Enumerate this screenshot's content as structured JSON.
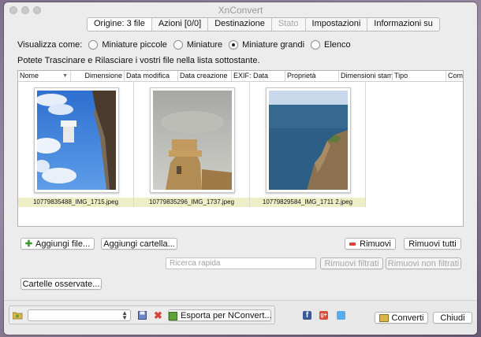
{
  "window": {
    "title": "XnConvert"
  },
  "tabs": [
    {
      "label": "Origine: 3 file",
      "state": "active"
    },
    {
      "label": "Azioni [0/0]",
      "state": "normal"
    },
    {
      "label": "Destinazione",
      "state": "normal"
    },
    {
      "label": "Stato",
      "state": "disabled"
    },
    {
      "label": "Impostazioni",
      "state": "normal"
    },
    {
      "label": "Informazioni su",
      "state": "normal"
    }
  ],
  "view": {
    "label": "Visualizza come:",
    "options": [
      "Miniature piccole",
      "Miniature",
      "Miniature grandi",
      "Elenco"
    ],
    "selected": "Miniature grandi"
  },
  "hint": "Potete Trascinare e Rilasciare i vostri file nella lista sottostante.",
  "columns": [
    "Nome",
    "Dimensione",
    "Data modifica",
    "Data creazione",
    "EXIF: Data",
    "Proprietà",
    "Dimensioni stamp",
    "Tipo",
    "Comm"
  ],
  "files": [
    {
      "name": "10779835488_IMG_1715.jpeg",
      "thumb": "lighthouse-sky"
    },
    {
      "name": "10779835296_IMG_1737.jpeg",
      "thumb": "stone-tower"
    },
    {
      "name": "10779829584_IMG_1711 2.jpeg",
      "thumb": "sea-cliff"
    }
  ],
  "buttons": {
    "add_files": "Aggiungi file...",
    "add_folder": "Aggiungi cartella...",
    "remove": "Rimuovi",
    "remove_all": "Rimuovi tutti",
    "remove_filtered": "Rimuovi filtrati",
    "remove_unfiltered": "Rimuovi non filtrati",
    "watched_folders": "Cartelle osservate...",
    "export": "Esporta per NConvert...",
    "convert": "Converti",
    "close": "Chiudi"
  },
  "search": {
    "placeholder": "Ricerca rapida",
    "value": ""
  },
  "preset": {
    "value": ""
  },
  "colors": {
    "accent_green": "#3f9a2d",
    "remove_red": "#d9443a",
    "facebook": "#3b5998",
    "gplus": "#dd4b39",
    "twitter": "#55acee",
    "caption_bg": "#efefc7"
  }
}
